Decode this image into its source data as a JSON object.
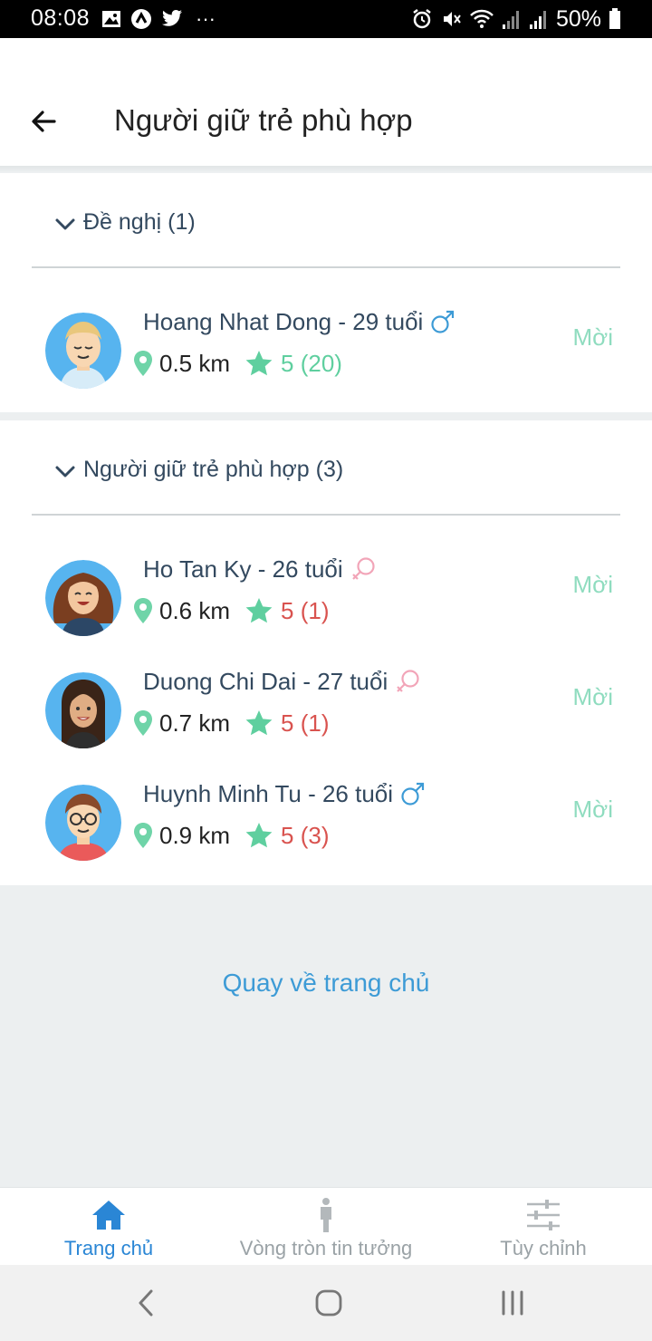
{
  "status_bar": {
    "time": "08:08",
    "dots": "···",
    "battery": "50%"
  },
  "header": {
    "title": "Người giữ trẻ phù hợp",
    "back_icon": "arrow-left-icon"
  },
  "sections": [
    {
      "label": "Đề nghị (1)",
      "people": [
        {
          "name_age": "Hoang Nhat Dong - 29 tuổi",
          "gender": "male",
          "distance": "0.5 km",
          "rating": "5 (20)",
          "rating_color": "#5fcf9f",
          "invite": "Mời",
          "avatar": "blond-man-avatar"
        }
      ]
    },
    {
      "label": "Người giữ trẻ phù hợp (3)",
      "people": [
        {
          "name_age": "Ho Tan Ky - 26 tuổi",
          "gender": "female",
          "distance": "0.6 km",
          "rating": "5 (1)",
          "rating_color": "#d9534f",
          "invite": "Mời",
          "avatar": "curly-hair-woman-avatar"
        },
        {
          "name_age": "Duong Chi Dai - 27 tuổi",
          "gender": "female",
          "distance": "0.7 km",
          "rating": "5 (1)",
          "rating_color": "#d9534f",
          "invite": "Mời",
          "avatar": "dark-hair-woman-avatar"
        },
        {
          "name_age": "Huynh Minh Tu - 26 tuổi",
          "gender": "male",
          "distance": "0.9 km",
          "rating": "5 (3)",
          "rating_color": "#d9534f",
          "invite": "Mời",
          "avatar": "glasses-man-avatar"
        }
      ]
    }
  ],
  "home_link": "Quay về trang chủ",
  "bottom_nav": [
    {
      "label": "Trang chủ",
      "icon": "home-icon",
      "active": true
    },
    {
      "label": "Vòng tròn tin tưởng",
      "icon": "person-icon",
      "active": false
    },
    {
      "label": "Tùy chỉnh",
      "icon": "sliders-icon",
      "active": false
    }
  ],
  "colors": {
    "accent_blue": "#2a86d5",
    "link_blue": "#3d9bd6",
    "green": "#5fcf9f",
    "invite_green": "#8fdcbf",
    "rating_red": "#d9534f",
    "male_blue": "#3d9bd6",
    "female_pink": "#f2a5b8"
  }
}
